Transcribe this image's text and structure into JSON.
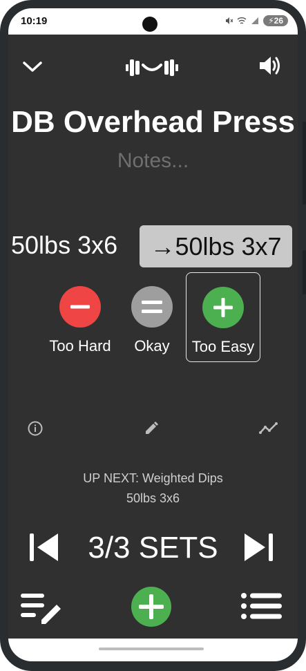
{
  "status": {
    "time": "10:19",
    "battery": "26"
  },
  "header": {
    "collapse_icon": "chevron-down-icon",
    "logo_icon": "dumbbell-smile-icon",
    "sound_icon": "speaker-icon"
  },
  "exercise": {
    "title": "DB Overhead Press",
    "notes_placeholder": "Notes..."
  },
  "progression": {
    "current": "50lbs 3x6",
    "next": "→50lbs 3x7"
  },
  "difficulty": {
    "options": [
      {
        "label": "Too Hard",
        "color": "#f04545"
      },
      {
        "label": "Okay",
        "color": "#9e9e9e"
      },
      {
        "label": "Too Easy",
        "color": "#4caf50"
      }
    ],
    "selected": "Too Easy"
  },
  "tools": {
    "info_icon": "info-icon",
    "edit_icon": "pencil-icon",
    "chart_icon": "trend-chart-icon"
  },
  "up_next": {
    "line1": "UP NEXT: Weighted Dips",
    "line2": "50lbs 3x6"
  },
  "sets": {
    "label": "3/3 SETS"
  },
  "bottom_nav": {
    "edit_list_icon": "edit-list-icon",
    "add_icon": "add-icon",
    "list_icon": "list-icon"
  },
  "colors": {
    "background": "#303030",
    "green": "#4caf50",
    "red": "#f04545",
    "gray": "#9e9e9e",
    "next_bg": "#c9c9c9"
  }
}
